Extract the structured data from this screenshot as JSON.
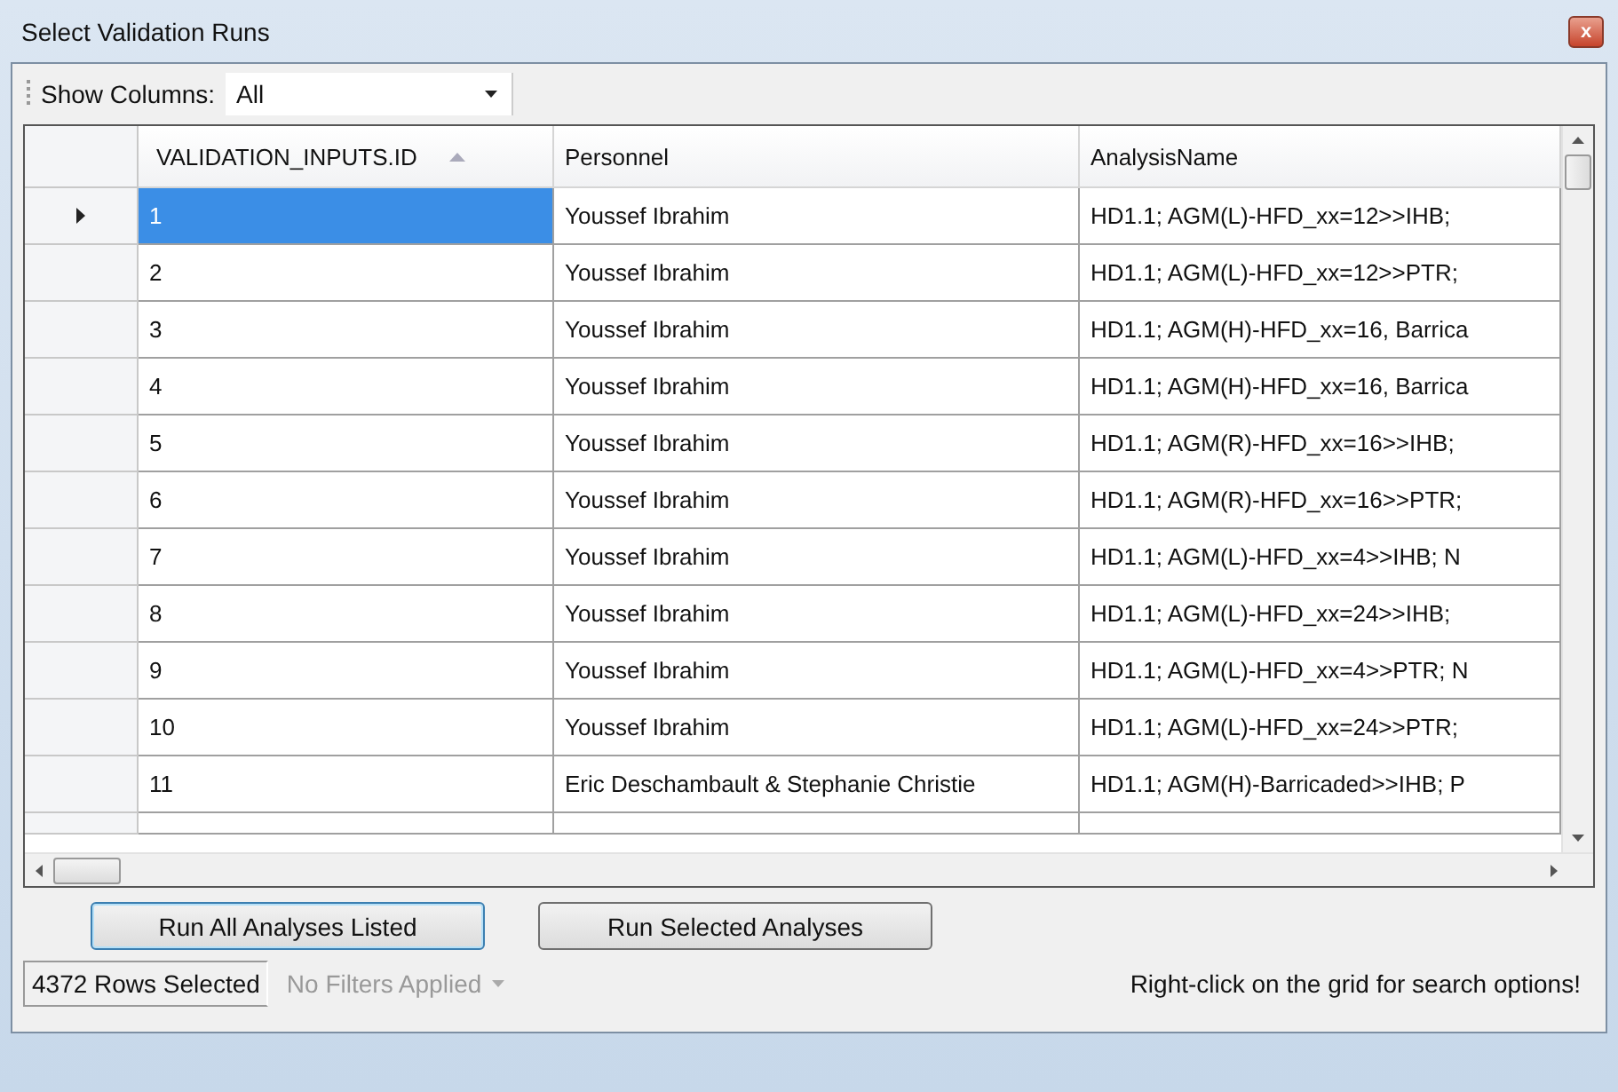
{
  "window": {
    "title": "Select Validation Runs",
    "close": "x"
  },
  "toolbar": {
    "label": "Show Columns:",
    "value": "All"
  },
  "table": {
    "columns": [
      {
        "label": "VALIDATION_INPUTS.ID",
        "sorted": true
      },
      {
        "label": "Personnel",
        "sorted": false
      },
      {
        "label": "AnalysisName",
        "sorted": false
      }
    ],
    "rows": [
      {
        "id": "1",
        "personnel": "Youssef Ibrahim",
        "analysis": "HD1.1; AGM(L)-HFD_xx=12>>IHB;",
        "selected": true
      },
      {
        "id": "2",
        "personnel": "Youssef Ibrahim",
        "analysis": "HD1.1; AGM(L)-HFD_xx=12>>PTR;",
        "selected": false
      },
      {
        "id": "3",
        "personnel": "Youssef Ibrahim",
        "analysis": "HD1.1; AGM(H)-HFD_xx=16, Barrica",
        "selected": false
      },
      {
        "id": "4",
        "personnel": "Youssef Ibrahim",
        "analysis": "HD1.1; AGM(H)-HFD_xx=16, Barrica",
        "selected": false
      },
      {
        "id": "5",
        "personnel": "Youssef Ibrahim",
        "analysis": "HD1.1; AGM(R)-HFD_xx=16>>IHB;",
        "selected": false
      },
      {
        "id": "6",
        "personnel": "Youssef Ibrahim",
        "analysis": "HD1.1; AGM(R)-HFD_xx=16>>PTR;",
        "selected": false
      },
      {
        "id": "7",
        "personnel": "Youssef Ibrahim",
        "analysis": "HD1.1; AGM(L)-HFD_xx=4>>IHB; N",
        "selected": false
      },
      {
        "id": "8",
        "personnel": "Youssef Ibrahim",
        "analysis": "HD1.1; AGM(L)-HFD_xx=24>>IHB;",
        "selected": false
      },
      {
        "id": "9",
        "personnel": "Youssef Ibrahim",
        "analysis": "HD1.1; AGM(L)-HFD_xx=4>>PTR; N",
        "selected": false
      },
      {
        "id": "10",
        "personnel": "Youssef Ibrahim",
        "analysis": "HD1.1; AGM(L)-HFD_xx=24>>PTR;",
        "selected": false
      },
      {
        "id": "11",
        "personnel": "Eric Deschambault & Stephanie Christie",
        "analysis": "HD1.1; AGM(H)-Barricaded>>IHB; P",
        "selected": false
      }
    ]
  },
  "buttons": [
    {
      "label": "Run All Analyses Listed",
      "focused": true
    },
    {
      "label": "Run Selected Analyses",
      "focused": false
    }
  ],
  "status_bar": {
    "rows_selected": "4372 Rows Selected",
    "filters": "No Filters Applied",
    "hint": "Right-click on the grid for search options!"
  }
}
